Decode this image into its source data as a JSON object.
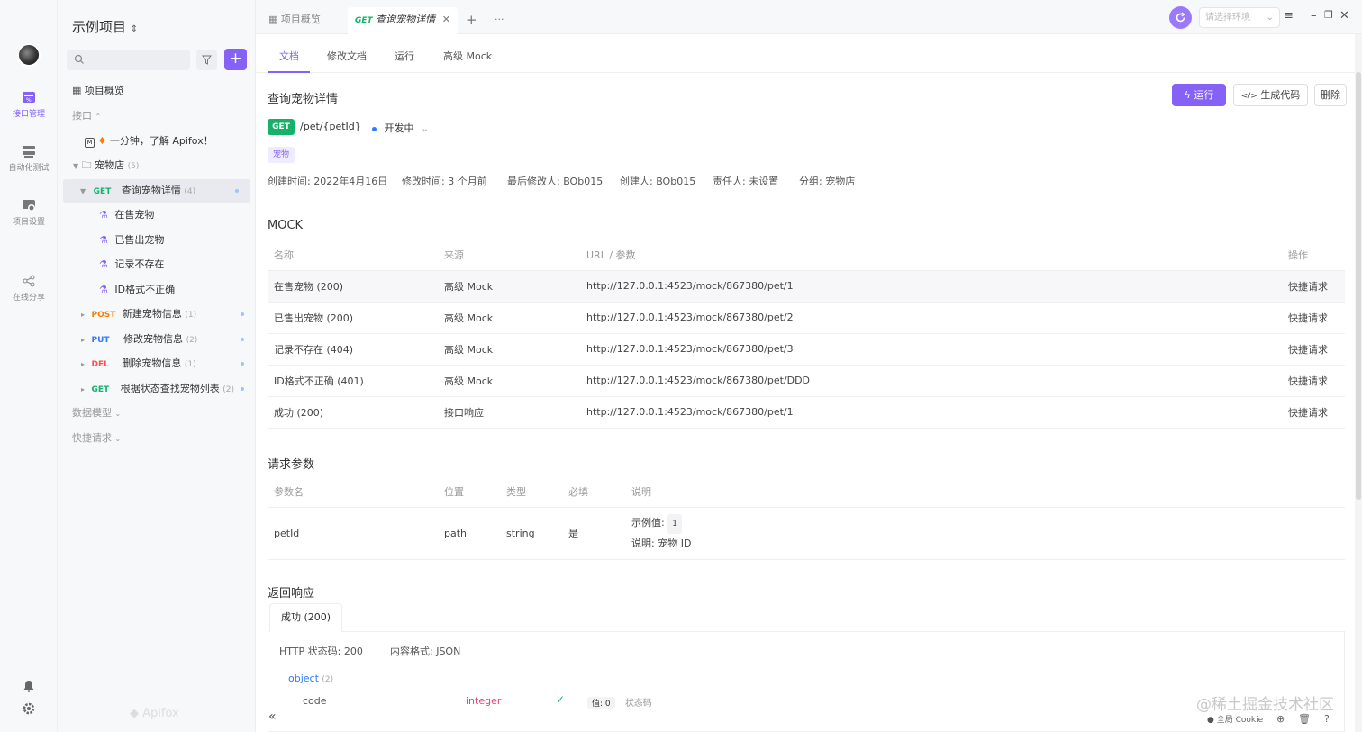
{
  "colors": {
    "accent": "#8562f5",
    "get": "#17b26a",
    "post": "#ff7a00",
    "put": "#2f7bff",
    "del": "#ff4d4f"
  },
  "rail": {
    "items": [
      {
        "label": "接口管理",
        "icon": "api-management-icon"
      },
      {
        "label": "自动化测试",
        "icon": "automation-test-icon"
      },
      {
        "label": "项目设置",
        "icon": "project-settings-icon"
      },
      {
        "label": "在线分享",
        "icon": "share-icon"
      }
    ]
  },
  "tree": {
    "project_title": "示例项目",
    "overview": "项目概览",
    "section_api": "接口",
    "intro_doc": "一分钟，了解 Apifox！",
    "folder": {
      "name": "宠物店",
      "count": "(5)"
    },
    "selected": {
      "method": "GET",
      "name": "查询宠物详情",
      "count": "(4)"
    },
    "cases": [
      "在售宠物",
      "已售出宠物",
      "记录不存在",
      "ID格式不正确"
    ],
    "endpoints": [
      {
        "method": "POST",
        "name": "新建宠物信息",
        "count": "(1)"
      },
      {
        "method": "PUT",
        "name": "修改宠物信息",
        "count": "(2)"
      },
      {
        "method": "DEL",
        "name": "删除宠物信息",
        "count": "(1)"
      },
      {
        "method": "GET",
        "name": "根据状态查找宠物列表",
        "count": "(2)"
      }
    ],
    "section_models": "数据模型",
    "section_quick": "快捷请求",
    "footer_logo": "Apifox"
  },
  "tabs": {
    "overview": "项目概览",
    "active_method": "GET",
    "active_name": "查询宠物详情",
    "env_placeholder": "请选择环境"
  },
  "subtabs": [
    "文档",
    "修改文档",
    "运行",
    "高级 Mock"
  ],
  "doc": {
    "title": "查询宠物详情",
    "run_label": "运行",
    "code_label": "生成代码",
    "delete_label": "删除",
    "method": "GET",
    "path": "/pet/{petId}",
    "status": "开发中",
    "tag": "宠物",
    "meta": {
      "created": "创建时间: 2022年4月16日",
      "modified": "修改时间: 3 个月前",
      "last_modifier": "最后修改人: BOb015",
      "creator": "创建人: BOb015",
      "owner": "责任人: 未设置",
      "group": "分组: 宠物店"
    }
  },
  "mock": {
    "heading": "MOCK",
    "headers": [
      "名称",
      "来源",
      "URL / 参数",
      "操作"
    ],
    "rows": [
      {
        "name": "在售宠物 (200)",
        "source": "高级 Mock",
        "url": "http://127.0.0.1:4523/mock/867380/pet/1",
        "action": "快捷请求"
      },
      {
        "name": "已售出宠物 (200)",
        "source": "高级 Mock",
        "url": "http://127.0.0.1:4523/mock/867380/pet/2",
        "action": "快捷请求"
      },
      {
        "name": "记录不存在 (404)",
        "source": "高级 Mock",
        "url": "http://127.0.0.1:4523/mock/867380/pet/3",
        "action": "快捷请求"
      },
      {
        "name": "ID格式不正确 (401)",
        "source": "高级 Mock",
        "url": "http://127.0.0.1:4523/mock/867380/pet/DDD",
        "action": "快捷请求"
      },
      {
        "name": "成功 (200)",
        "source": "接口响应",
        "url": "http://127.0.0.1:4523/mock/867380/pet/1",
        "action": "快捷请求"
      }
    ]
  },
  "params": {
    "heading": "请求参数",
    "headers": [
      "参数名",
      "位置",
      "类型",
      "必填",
      "说明"
    ],
    "rows": [
      {
        "name": "petId",
        "location": "path",
        "type": "string",
        "required": "是",
        "example_label": "示例值:",
        "example_value": "1",
        "desc_label": "说明:",
        "desc": "宠物 ID"
      }
    ]
  },
  "response": {
    "heading": "返回响应",
    "tab": "成功 (200)",
    "http_status": "HTTP 状态码: 200",
    "content_type": "内容格式: JSON",
    "root": "object",
    "root_count": "(2)",
    "field": {
      "name": "code",
      "type": "integer",
      "value": "值: 0",
      "desc": "状态码"
    }
  },
  "statusbar": {
    "cookie": "全局 Cookie"
  },
  "watermark": "@稀土掘金技术社区"
}
